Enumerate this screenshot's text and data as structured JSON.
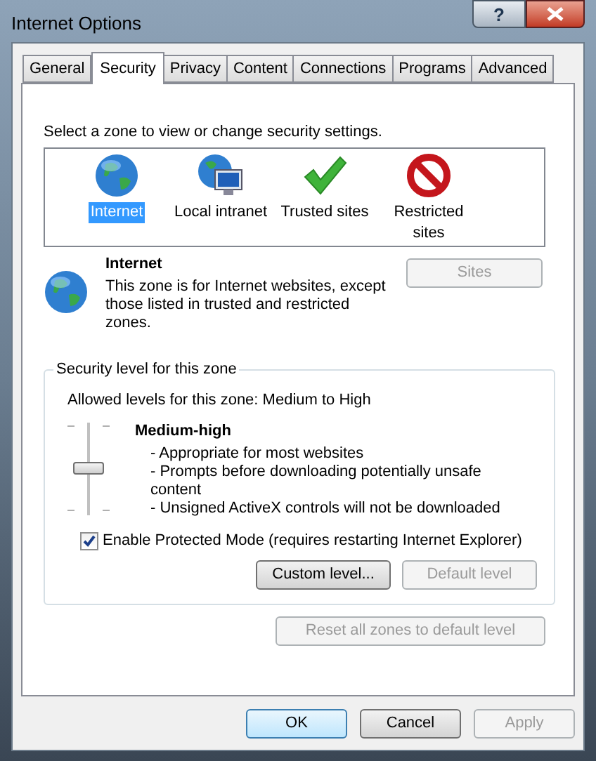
{
  "window": {
    "title": "Internet Options",
    "help_button": "?"
  },
  "tabs": [
    {
      "label": "General",
      "selected": false
    },
    {
      "label": "Security",
      "selected": true
    },
    {
      "label": "Privacy",
      "selected": false
    },
    {
      "label": "Content",
      "selected": false
    },
    {
      "label": "Connections",
      "selected": false
    },
    {
      "label": "Programs",
      "selected": false
    },
    {
      "label": "Advanced",
      "selected": false
    }
  ],
  "zone_prompt": "Select a zone to view or change security settings.",
  "zones": [
    {
      "label": "Internet",
      "kind": "globe",
      "selected": true
    },
    {
      "label": "Local intranet",
      "kind": "intranet",
      "selected": false
    },
    {
      "label": "Trusted sites",
      "kind": "trusted",
      "selected": false
    },
    {
      "label": "Restricted sites",
      "kind": "restricted",
      "selected": false
    }
  ],
  "zone_info": {
    "title": "Internet",
    "description": "This zone is for Internet websites, except those listed in trusted and restricted zones.",
    "sites_button": {
      "label": "Sites",
      "disabled": true
    }
  },
  "security_level": {
    "legend": "Security level for this zone",
    "allowed": "Allowed levels for this zone: Medium to High",
    "slider": {
      "level": 0.5
    },
    "level_name": "Medium-high",
    "bullets": [
      "- Appropriate for most websites",
      "- Prompts before downloading potentially unsafe content",
      "- Unsigned ActiveX controls will not be downloaded"
    ],
    "protected_mode": {
      "label": "Enable Protected Mode (requires restarting Internet Explorer)",
      "checked": true
    },
    "buttons": [
      {
        "label": "Custom level...",
        "disabled": false
      },
      {
        "label": "Default level",
        "disabled": true
      }
    ]
  },
  "reset_button": {
    "label": "Reset all zones to default level",
    "disabled": true
  },
  "buttons": [
    {
      "label": "OK",
      "default": true,
      "disabled": false
    },
    {
      "label": "Cancel",
      "default": false,
      "disabled": false
    },
    {
      "label": "Apply",
      "default": false,
      "disabled": true
    }
  ]
}
